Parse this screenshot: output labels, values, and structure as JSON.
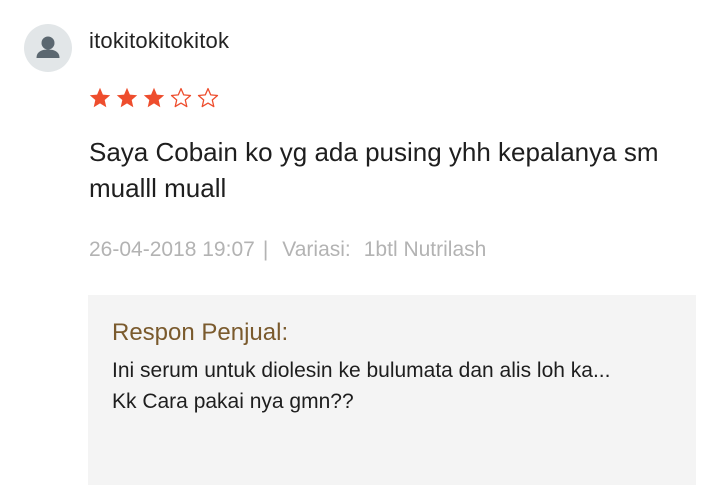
{
  "review": {
    "username": "itokitokitokitok",
    "rating": 3,
    "max_rating": 5,
    "comment": "Saya Cobain ko yg ada pusing yhh kepalanya sm mualll muall",
    "date": "26-04-2018 19:07",
    "separator": "|",
    "variation_label": "Variasi:",
    "variation_value": "1btl Nutrilash"
  },
  "seller_reply": {
    "title": "Respon Penjual:",
    "text": "Ini serum untuk diolesin ke bulumata dan alis loh ka...\nKk Cara pakai nya gmn??"
  },
  "colors": {
    "star_filled": "#ee4d2d",
    "reply_title": "#7a5a2d",
    "meta_text": "#b3b3b3",
    "reply_bg": "#f4f4f4"
  },
  "icons": {
    "avatar": "user-placeholder-icon",
    "star_filled": "star-filled-icon",
    "star_empty": "star-outline-icon"
  }
}
